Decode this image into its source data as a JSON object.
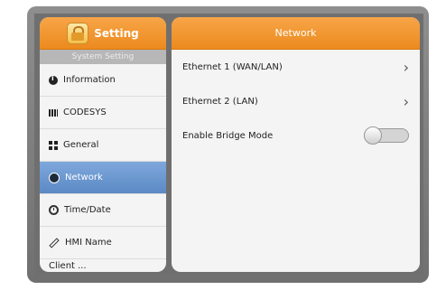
{
  "left": {
    "title": "Setting",
    "subtitle": "System Setting",
    "items": [
      {
        "label": "Information",
        "icon": "info-icon"
      },
      {
        "label": "CODESYS",
        "icon": "codesys-icon"
      },
      {
        "label": "General",
        "icon": "general-icon"
      },
      {
        "label": "Network",
        "icon": "network-icon"
      },
      {
        "label": "Time/Date",
        "icon": "clock-icon"
      },
      {
        "label": "HMI Name",
        "icon": "pen-icon"
      },
      {
        "label": "Client ...",
        "icon": "partial-icon"
      }
    ],
    "active_item": "Network"
  },
  "right": {
    "title": "Network",
    "rows": [
      {
        "label": "Ethernet 1 (WAN/LAN)",
        "type": "nav"
      },
      {
        "label": "Ethernet 2 (LAN)",
        "type": "nav"
      },
      {
        "label": "Enable Bridge Mode",
        "type": "toggle",
        "value": "off"
      }
    ]
  },
  "colors": {
    "header_orange": "#ec8a1e",
    "active_blue": "#5c89c5",
    "panel_bg": "#f4f4f4"
  }
}
